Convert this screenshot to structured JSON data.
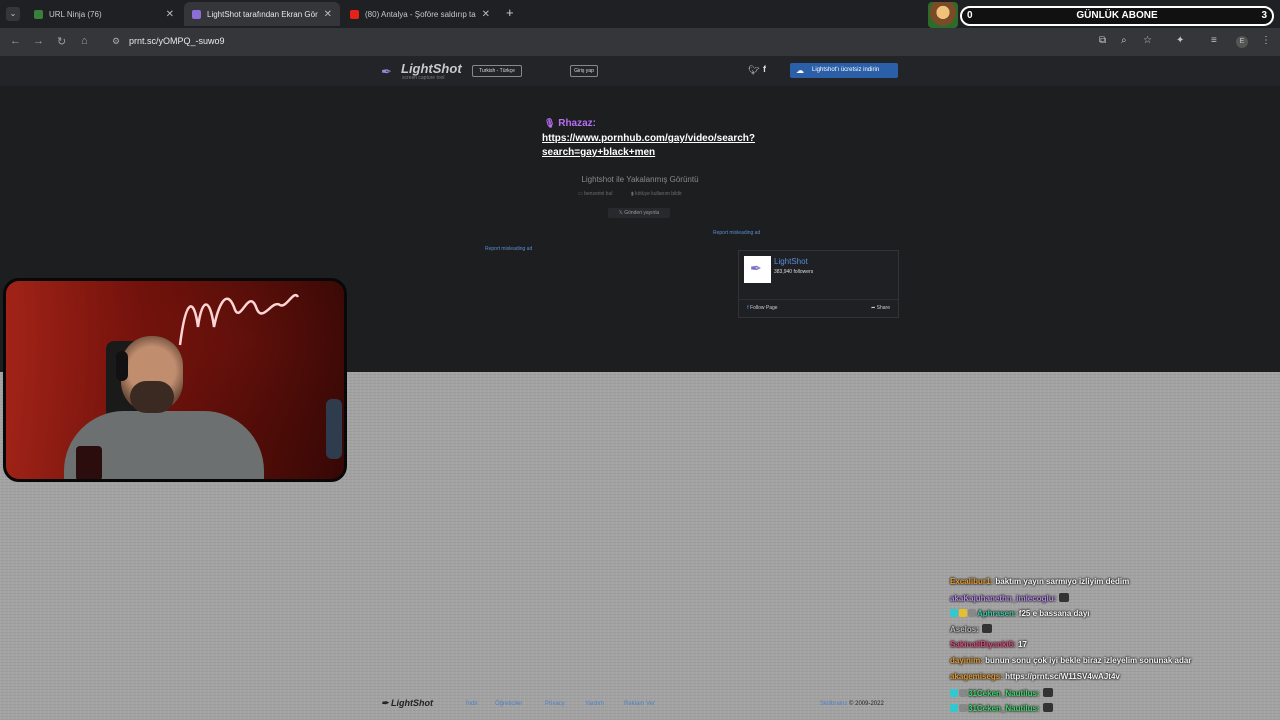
{
  "browser": {
    "tabs": [
      {
        "title": "URL Ninja (76)",
        "color": "#3a7f3a"
      },
      {
        "title": "LightShot tarafından Ekran Görü",
        "color": "#8b6ed8"
      },
      {
        "title": "(80) Antalya - Şoföre saldırıp ta",
        "color": "#e62117"
      }
    ],
    "url": "prnt.sc/yOMPQ_-suwo9"
  },
  "overlay": {
    "sub_goal_label": "GÜNLÜK ABONE",
    "sub_count_left": "0",
    "sub_count_right": "3"
  },
  "lightshot": {
    "logo_text": "LightShot",
    "logo_sub": "screen capture tool",
    "language_button": "Turkish - Türkçe",
    "login_button": "Giriş yap",
    "download_button": "Lightshot'ı ücretsiz indirin",
    "chat_username": "Rhazaz:",
    "chat_url_line1": "https://www.pornhub.com/gay/video/search?",
    "chat_url_line2": "search=gay+black+men",
    "screenshot_title": "Lightshot ile Yakalanmış Görüntü",
    "find_similar": "benzerini bul",
    "report_abuse": "kötüye kullanım bildir",
    "tweet_button": "Gönderi yayınla",
    "report_ad_left": "Report misleading ad",
    "report_ad_right": "Report misleading ad",
    "fb_name": "LightShot",
    "fb_followers": "383,940 followers",
    "fb_follow": "Follow Page",
    "fb_share": "Share",
    "footer": {
      "logo": "LightShot",
      "links": [
        "İndir",
        "Öğreticiler",
        "Privacy",
        "Yardım",
        "Reklam Ver"
      ],
      "company": "Skillbrains",
      "copyright": "© 2009-2022"
    }
  },
  "chat": [
    {
      "user": "Excalibur1:",
      "user_color": "#e39b2d",
      "msg": "baktım yayın sarmıyo izliyim dedim",
      "badges": []
    },
    {
      "user": "akaKajuhanethn_imlecoglu:",
      "user_color": "#b38ae6",
      "msg": "",
      "badges": [],
      "emote": true
    },
    {
      "user": "Aphrasen:",
      "user_color": "#3ec7a3",
      "msg": "f25 e bassana dayı",
      "badges": [
        "#30c9d0",
        "#e6c02a",
        "#888888"
      ]
    },
    {
      "user": "Aselos:",
      "user_color": "#b8b8b8",
      "msg": "",
      "badges": [],
      "emote": true
    },
    {
      "user": "SakinaliBiyanki6:",
      "user_color": "#e0487a",
      "msg": "17",
      "badges": []
    },
    {
      "user": "dayinim:",
      "user_color": "#e39b2d",
      "msg": "bunun sonu çok iyi bekle biraz izleyelim sonunak adar",
      "badges": []
    },
    {
      "user": "akagemisegs:",
      "user_color": "#e39b2d",
      "msg": "https://prnt.sc/W11SV4wAJt4v",
      "badges": []
    },
    {
      "user": "31Ceken_Nautilus:",
      "user_color": "#3ed66b",
      "msg": "",
      "badges": [
        "#30c9d0",
        "#888888"
      ],
      "emote": true
    },
    {
      "user": "31Ceken_Nautilus:",
      "user_color": "#3ed66b",
      "msg": "",
      "badges": [
        "#30c9d0",
        "#888888"
      ],
      "emote": true
    }
  ]
}
